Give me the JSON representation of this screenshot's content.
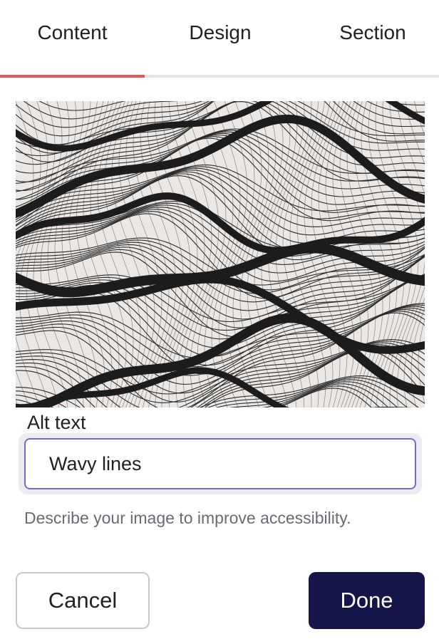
{
  "tabs": [
    {
      "label": "Content",
      "active": true
    },
    {
      "label": "Design",
      "active": false
    },
    {
      "label": "Section",
      "active": false
    }
  ],
  "colors": {
    "active_tab_indicator": "#e05a5a",
    "input_focus_border": "#7b63d8",
    "primary_button": "#15154a"
  },
  "image": {
    "description": "Wavy lines"
  },
  "alt_text": {
    "label": "Alt text",
    "value": "Wavy lines",
    "helper": "Describe your image to improve accessibility."
  },
  "actions": {
    "cancel_label": "Cancel",
    "done_label": "Done"
  }
}
